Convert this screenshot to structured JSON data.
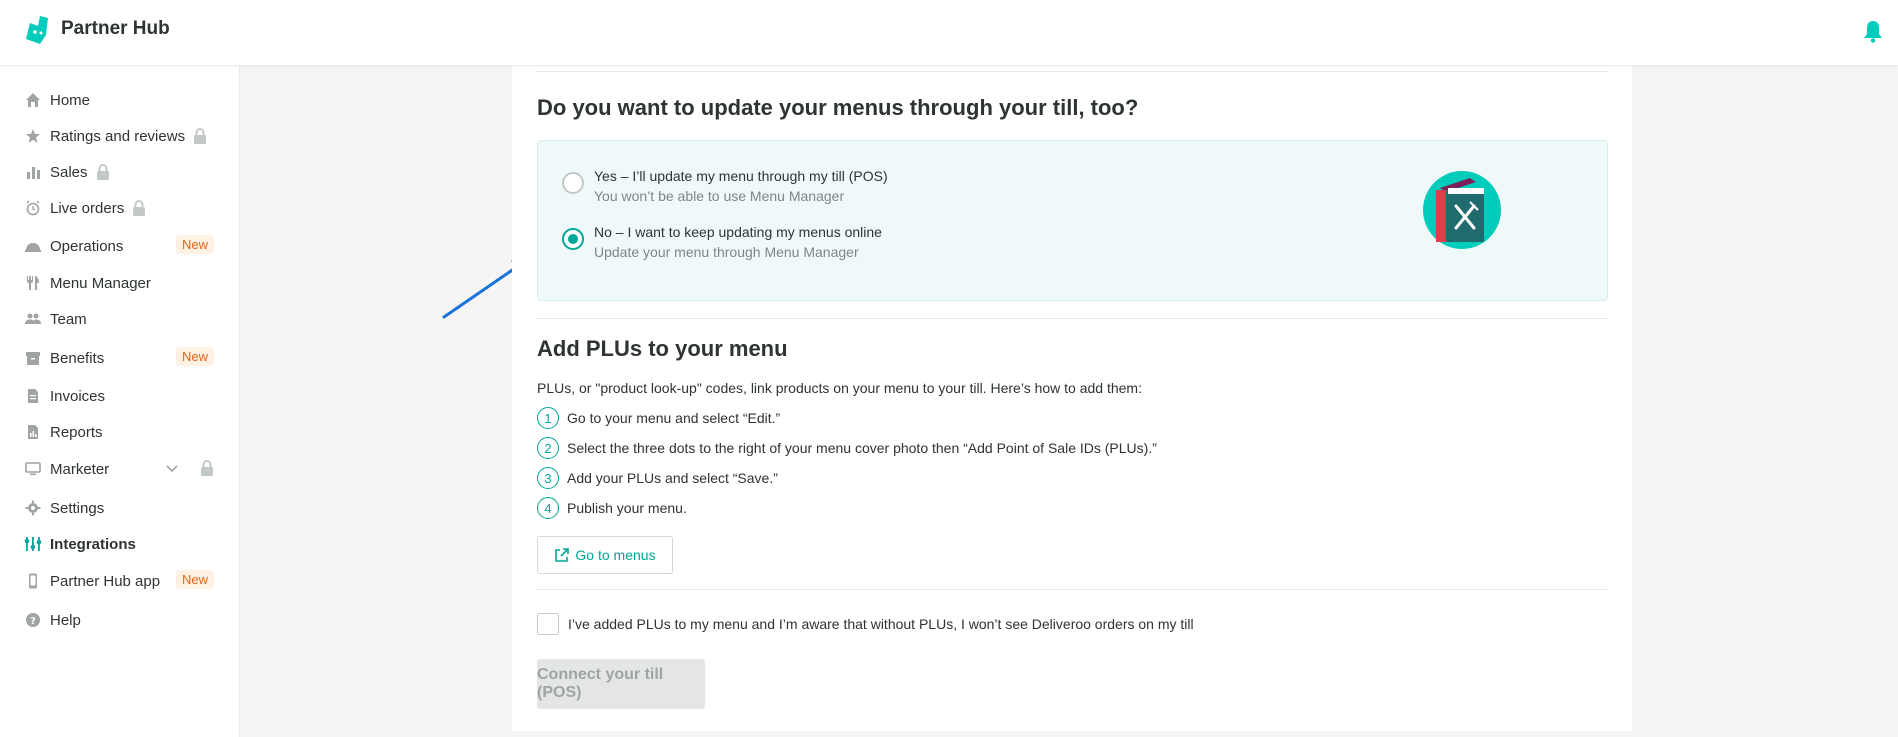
{
  "header": {
    "brand": "Partner Hub"
  },
  "sidebar": {
    "items": [
      {
        "label": "Home",
        "icon": "home-icon"
      },
      {
        "label": "Ratings and reviews",
        "icon": "star-icon",
        "locked": true
      },
      {
        "label": "Sales",
        "icon": "bar-chart-icon",
        "locked": true
      },
      {
        "label": "Live orders",
        "icon": "alarm-clock-icon",
        "locked": true
      },
      {
        "label": "Operations",
        "icon": "cloche-icon",
        "badge": "New"
      },
      {
        "label": "Menu Manager",
        "icon": "cutlery-icon"
      },
      {
        "label": "Team",
        "icon": "people-icon"
      },
      {
        "label": "Benefits",
        "icon": "archive-icon",
        "badge": "New"
      },
      {
        "label": "Invoices",
        "icon": "document-icon"
      },
      {
        "label": "Reports",
        "icon": "report-icon"
      },
      {
        "label": "Marketer",
        "icon": "monitor-icon",
        "locked": true,
        "expandable": true
      },
      {
        "label": "Settings",
        "icon": "gear-icon"
      },
      {
        "label": "Integrations",
        "icon": "sliders-icon",
        "active": true
      },
      {
        "label": "Partner Hub app",
        "icon": "phone-icon",
        "badge": "New"
      },
      {
        "label": "Help",
        "icon": "help-icon"
      }
    ]
  },
  "section1": {
    "title": "Do you want to update your menus through your till, too?",
    "options": [
      {
        "title": "Yes – I’ll update my menu through my till (POS)",
        "subtitle": "You won’t be able to use Menu Manager",
        "selected": false
      },
      {
        "title": "No – I want to keep updating my menus online",
        "subtitle": "Update your menu through Menu Manager",
        "selected": true
      }
    ]
  },
  "section2": {
    "title": "Add PLUs to your menu",
    "description": "PLUs, or \"product look-up\" codes, link products on your menu to your till. Here’s how to add them:",
    "steps": [
      {
        "num": "1",
        "text": "Go to your menu and select “Edit.”"
      },
      {
        "num": "2",
        "text": "Select the three dots to the right of your menu cover photo then “Add Point of Sale IDs (PLUs).”"
      },
      {
        "num": "3",
        "text": "Add your PLUs and select “Save.”"
      },
      {
        "num": "4",
        "text": "Publish your menu."
      }
    ],
    "goto_button": "Go to menus"
  },
  "confirm": {
    "label": "I’ve added PLUs to my menu and I’m aware that without PLUs, I won’t see Deliveroo orders on my till",
    "checked": false
  },
  "connect_button": "Connect your till (POS)",
  "colors": {
    "accent": "#00a79a",
    "badge_text": "#e0661b",
    "badge_bg": "#fff2e5",
    "annotation_arrow": "#1a73d9"
  }
}
